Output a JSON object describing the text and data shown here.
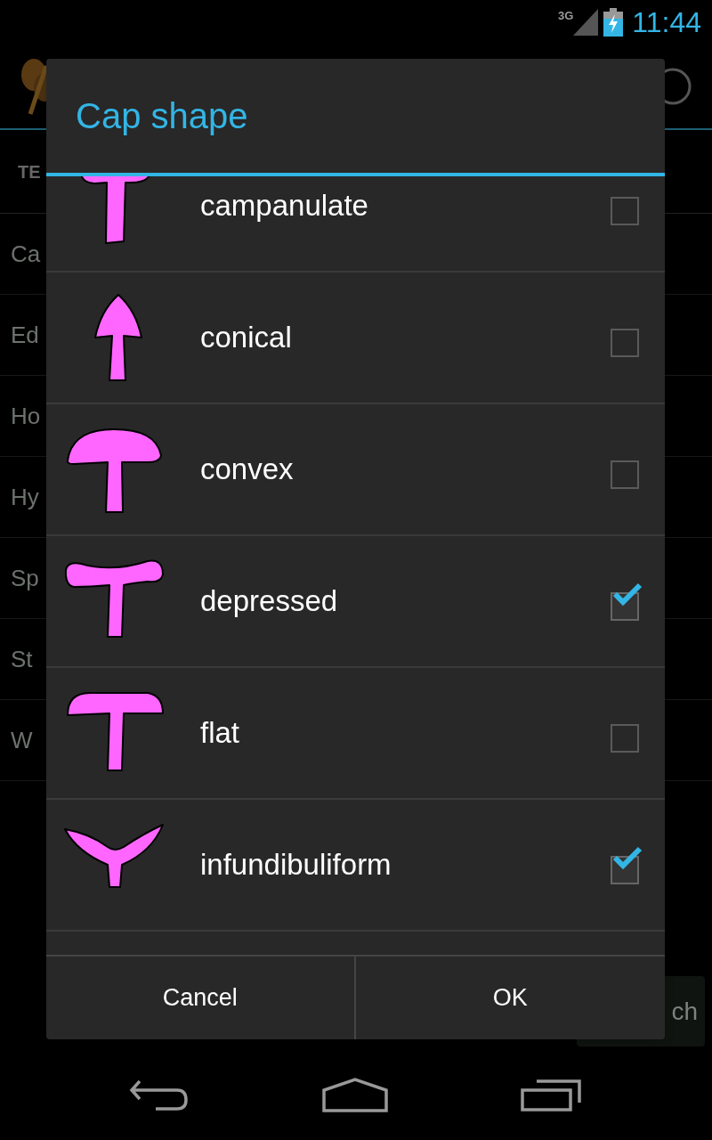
{
  "status_bar": {
    "network": "3G",
    "time": "11:44"
  },
  "background": {
    "tab": "TE",
    "list": [
      "Ca",
      "Ed",
      "Ho",
      "Hy",
      "Sp",
      "St",
      "W"
    ],
    "search_button": "ch"
  },
  "dialog": {
    "title": "Cap shape",
    "options": [
      {
        "label": "campanulate",
        "checked": false
      },
      {
        "label": "conical",
        "checked": false
      },
      {
        "label": "convex",
        "checked": false
      },
      {
        "label": "depressed",
        "checked": true
      },
      {
        "label": "flat",
        "checked": false
      },
      {
        "label": "infundibuliform",
        "checked": true
      }
    ],
    "buttons": [
      "Cancel",
      "OK"
    ]
  }
}
